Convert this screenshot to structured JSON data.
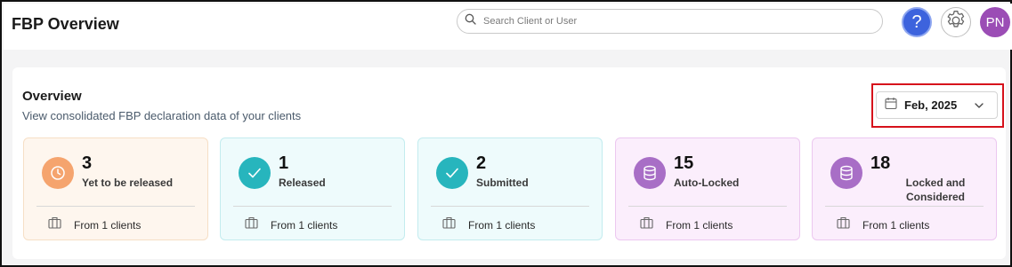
{
  "app": {
    "title": "FBP Overview"
  },
  "search": {
    "placeholder": "Search Client or User"
  },
  "header": {
    "help_glyph": "?",
    "avatar_initials": "PN"
  },
  "overview": {
    "title": "Overview",
    "subtitle": "View consolidated FBP declaration data of your clients",
    "month": "Feb, 2025"
  },
  "cards": [
    {
      "count": "3",
      "label": "Yet to be released",
      "footer": "From 1 clients",
      "icon": "clock-icon",
      "bg": "#fef6ee",
      "border": "#f6dfc6",
      "circle": "#f5a46e"
    },
    {
      "count": "1",
      "label": "Released",
      "footer": "From 1 clients",
      "icon": "check-icon",
      "bg": "#eefbfc",
      "border": "#c3ecef",
      "circle": "#27b5bd"
    },
    {
      "count": "2",
      "label": "Submitted",
      "footer": "From 1 clients",
      "icon": "check-icon",
      "bg": "#eefbfc",
      "border": "#c3ecef",
      "circle": "#27b5bd"
    },
    {
      "count": "15",
      "label": "Auto-Locked",
      "footer": "From 1 clients",
      "icon": "database-icon",
      "bg": "#fbeefc",
      "border": "#ecc8f0",
      "circle": "#a86ec6"
    },
    {
      "count": "18",
      "label": "Locked and Considered",
      "footer": "From 1 clients",
      "icon": "database-icon",
      "bg": "#fbeefc",
      "border": "#ecc8f0",
      "circle": "#a86ec6"
    }
  ]
}
